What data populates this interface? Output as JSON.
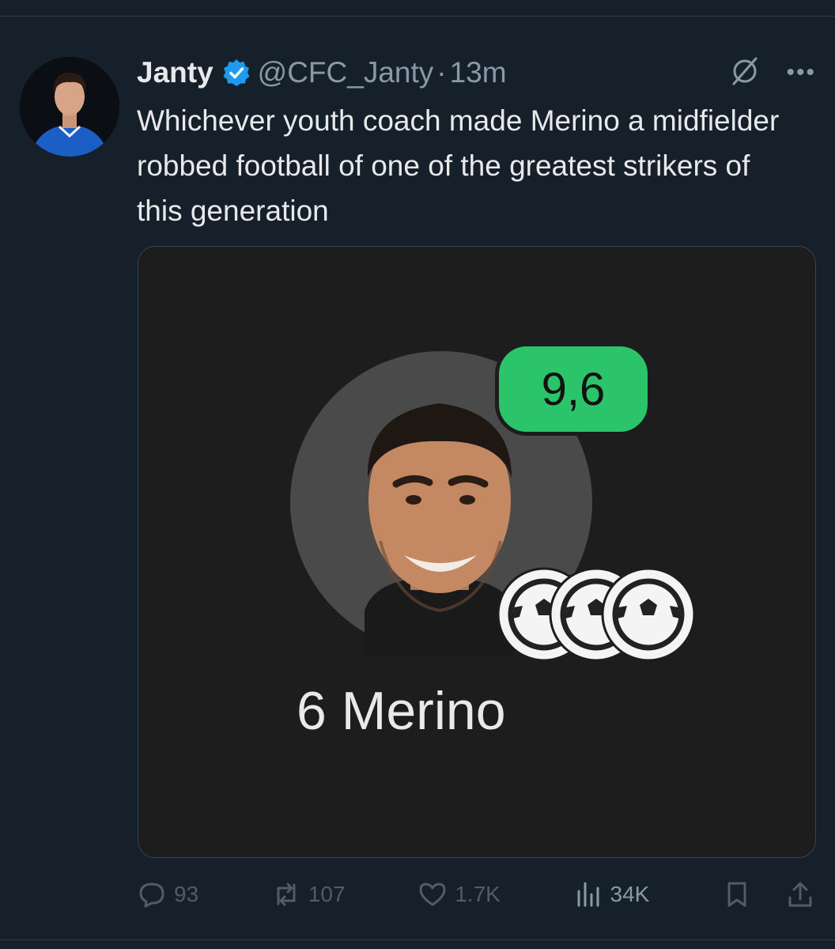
{
  "author": {
    "display_name": "Janty",
    "handle": "@CFC_Janty",
    "separator": "·",
    "time": "13m"
  },
  "tweet": {
    "text": "Whichever youth coach made Merino a midfielder robbed football of one of the greatest strikers of this generation"
  },
  "media": {
    "rating": "9,6",
    "player_label": "6 Merino",
    "goals_shown": 3,
    "rating_color": "#2cc46b"
  },
  "actions": {
    "replies": "93",
    "reposts": "107",
    "likes": "1.7K",
    "views": "34K"
  },
  "colors": {
    "background": "#15202b",
    "verified": "#1d9bf0",
    "muted_text": "#8b98a5"
  },
  "icons": [
    "grok-icon",
    "more-icon",
    "reply-icon",
    "repost-icon",
    "like-icon",
    "views-icon",
    "bookmark-icon",
    "share-icon",
    "verified-badge-icon",
    "football-icon"
  ]
}
